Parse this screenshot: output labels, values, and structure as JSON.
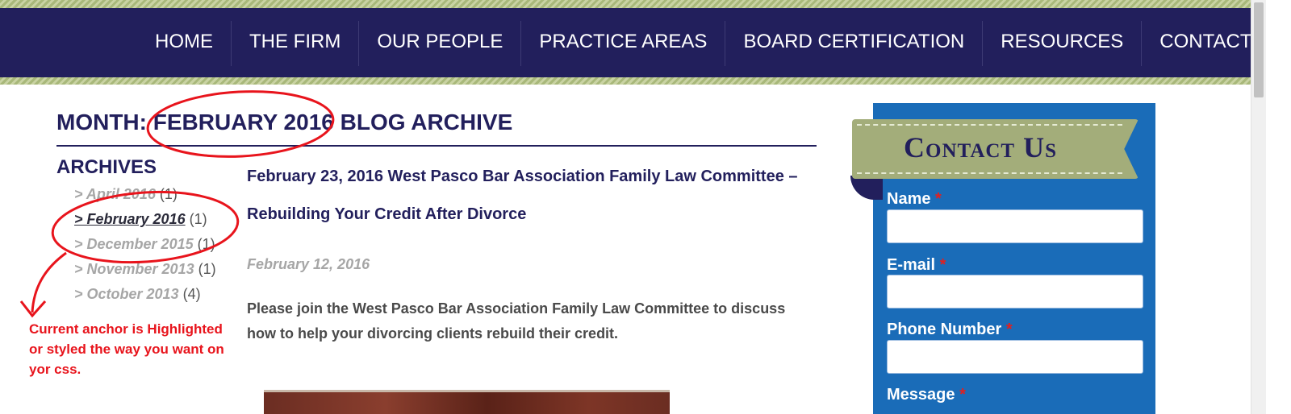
{
  "nav": {
    "items": [
      "HOME",
      "THE FIRM",
      "OUR PEOPLE",
      "PRACTICE AREAS",
      "BOARD CERTIFICATION",
      "RESOURCES",
      "CONTACT US"
    ]
  },
  "main": {
    "page_title": "MONTH: FEBRUARY 2016 BLOG ARCHIVE",
    "archives_heading": "ARCHIVES",
    "archives": [
      {
        "label": "> April 2016",
        "count": "(1)",
        "current": false
      },
      {
        "label": "> February 2016",
        "count": "(1)",
        "current": true
      },
      {
        "label": "> December 2015",
        "count": "(1)",
        "current": false
      },
      {
        "label": "> November 2013",
        "count": "(1)",
        "current": false
      },
      {
        "label": "> October 2013",
        "count": "(4)",
        "current": false
      }
    ],
    "post": {
      "title": "February 23, 2016 West Pasco Bar Association Family Law Committee – Rebuilding Your Credit After Divorce",
      "date": "February 12, 2016",
      "excerpt": "Please join the West Pasco Bar Association Family Law Committee to discuss how to help your divorcing clients rebuild their credit."
    }
  },
  "sidebar": {
    "ribbon_title": "Contact Us",
    "fields": [
      {
        "label": "Name",
        "required_mark": "*"
      },
      {
        "label": "E-mail",
        "required_mark": "*"
      },
      {
        "label": "Phone Number",
        "required_mark": "*"
      },
      {
        "label": "Message",
        "required_mark": "*"
      }
    ]
  },
  "annotation": {
    "note": "Current anchor is Highlighted or styled the way you want on yor css.",
    "color": "#e8141c"
  },
  "colors": {
    "navy": "#221f5c",
    "sidebar_blue": "#1a6cb8",
    "ribbon_green": "#a3ad7a"
  }
}
